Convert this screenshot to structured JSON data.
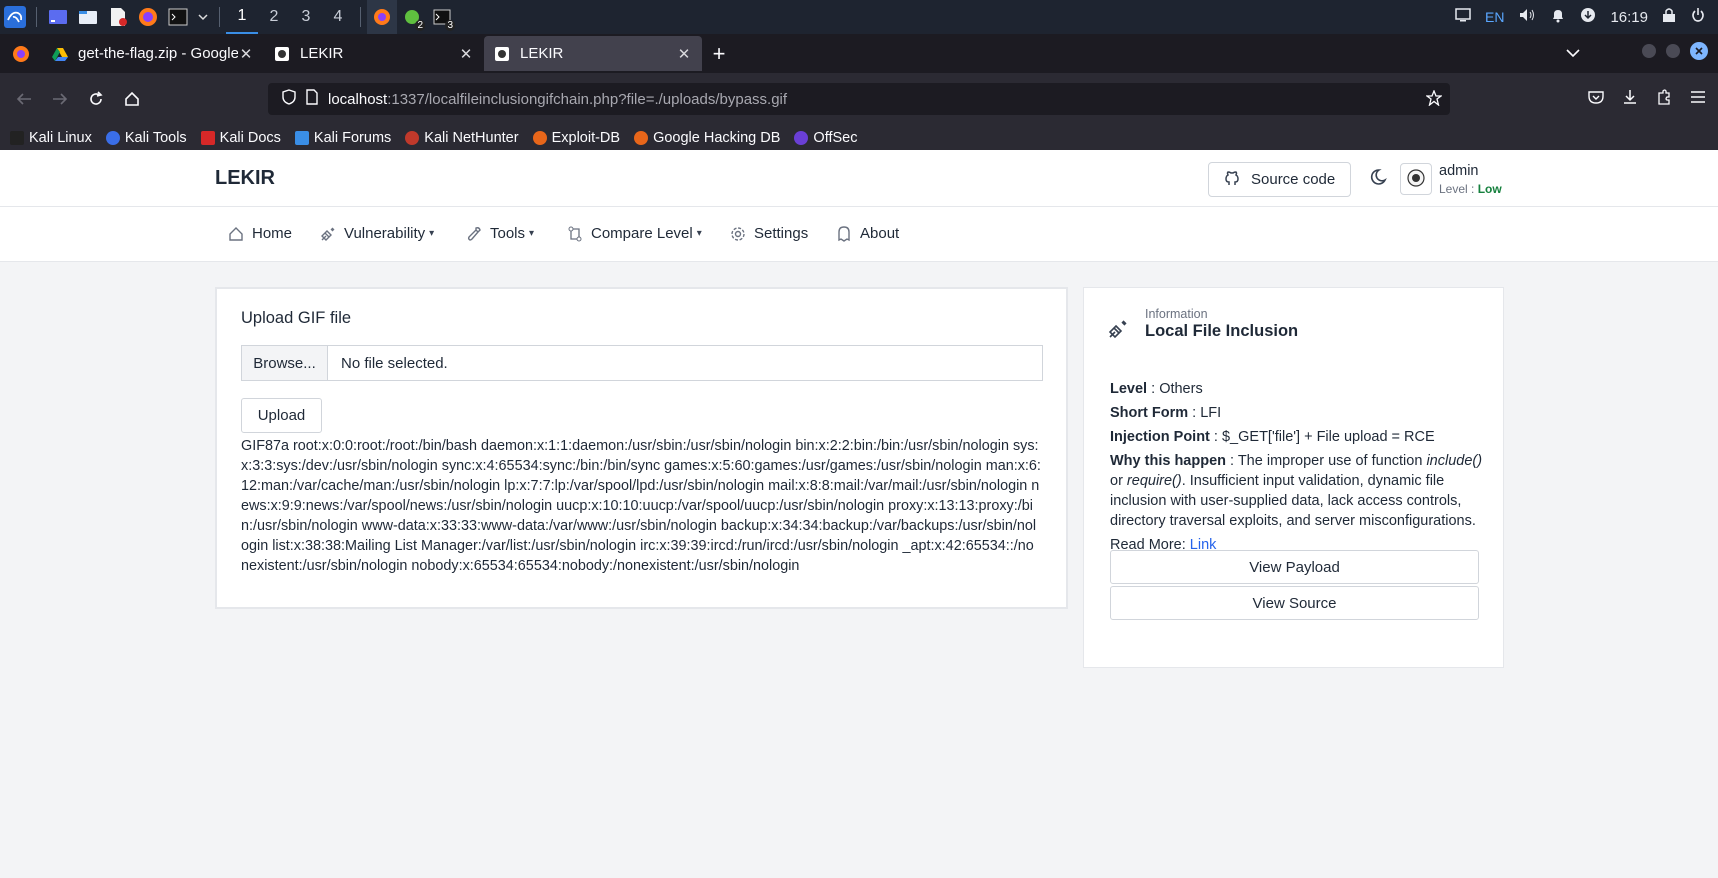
{
  "taskbar": {
    "workspaces": [
      "1",
      "2",
      "3",
      "4"
    ],
    "active_workspace": "1",
    "badges": {
      "app_a": "2",
      "app_b": "3"
    },
    "language": "EN",
    "clock": "16:19",
    "icons": [
      "kali-menu-icon",
      "desktop-icon",
      "file-manager-icon",
      "text-editor-icon",
      "firefox-icon",
      "terminal-icon",
      "chevron-down-icon",
      "firefox-taskbar-icon",
      "bug-app-icon",
      "terminal-taskbar-icon",
      "display-icon",
      "volume-icon",
      "bell-icon",
      "download-status-icon",
      "lock-icon",
      "power-icon"
    ]
  },
  "browser": {
    "tabs": [
      {
        "title": "get-the-flag.zip - Google",
        "favicon": "google-drive-icon",
        "active": false
      },
      {
        "title": "LEKIR",
        "favicon": "lekir-icon",
        "active": false
      },
      {
        "title": "LEKIR",
        "favicon": "lekir-icon",
        "active": true
      }
    ],
    "url_host": "localhost",
    "url_path": ":1337/localfileinclusiongifchain.php?file=./uploads/bypass.gif",
    "bookmarks": [
      "Kali Linux",
      "Kali Tools",
      "Kali Docs",
      "Kali Forums",
      "Kali NetHunter",
      "Exploit-DB",
      "Google Hacking DB",
      "OffSec"
    ]
  },
  "app": {
    "title": "LEKIR",
    "source_code_label": "Source code",
    "user": {
      "name": "admin",
      "level_label": "Level : ",
      "level_value": "Low"
    }
  },
  "menu": {
    "home": "Home",
    "vulnerability": "Vulnerability",
    "tools": "Tools",
    "compare_level": "Compare Level",
    "settings": "Settings",
    "about": "About"
  },
  "upload": {
    "title": "Upload GIF file",
    "browse_label": "Browse...",
    "file_status": "No file selected.",
    "upload_label": "Upload",
    "output": "GIF87a root:x:0:0:root:/root:/bin/bash daemon:x:1:1:daemon:/usr/sbin:/usr/sbin/nologin bin:x:2:2:bin:/bin:/usr/sbin/nologin sys:x:3:3:sys:/dev:/usr/sbin/nologin sync:x:4:65534:sync:/bin:/bin/sync games:x:5:60:games:/usr/games:/usr/sbin/nologin man:x:6:12:man:/var/cache/man:/usr/sbin/nologin lp:x:7:7:lp:/var/spool/lpd:/usr/sbin/nologin mail:x:8:8:mail:/var/mail:/usr/sbin/nologin news:x:9:9:news:/var/spool/news:/usr/sbin/nologin uucp:x:10:10:uucp:/var/spool/uucp:/usr/sbin/nologin proxy:x:13:13:proxy:/bin:/usr/sbin/nologin www-data:x:33:33:www-data:/var/www:/usr/sbin/nologin backup:x:34:34:backup:/var/backups:/usr/sbin/nologin list:x:38:38:Mailing List Manager:/var/list:/usr/sbin/nologin irc:x:39:39:ircd:/run/ircd:/usr/sbin/nologin _apt:x:42:65534::/nonexistent:/usr/sbin/nologin nobody:x:65534:65534:nobody:/nonexistent:/usr/sbin/nologin"
  },
  "info": {
    "label": "Information",
    "title": "Local File Inclusion",
    "level_key": "Level",
    "level_value": "Others",
    "short_form_key": "Short Form",
    "short_form_value": "LFI",
    "injection_key": "Injection Point",
    "injection_value": "$_GET['file'] + File upload = RCE",
    "why_key": "Why this happen",
    "why_text_1": "The improper use of function ",
    "why_fn_1": "include()",
    "why_or": " or ",
    "why_fn_2": "require()",
    "why_text_2": ". Insufficient input validation, dynamic file inclusion with user-supplied data, lack access controls, directory traversal exploits, and server misconfigurations.",
    "read_more_label": "Read More: ",
    "read_more_link": "Link",
    "view_payload_label": "View Payload",
    "view_source_label": "View Source"
  },
  "colors": {
    "accent_link": "#2563eb",
    "level_low": "#15803d",
    "workspace_active": "#3a8ee6"
  }
}
